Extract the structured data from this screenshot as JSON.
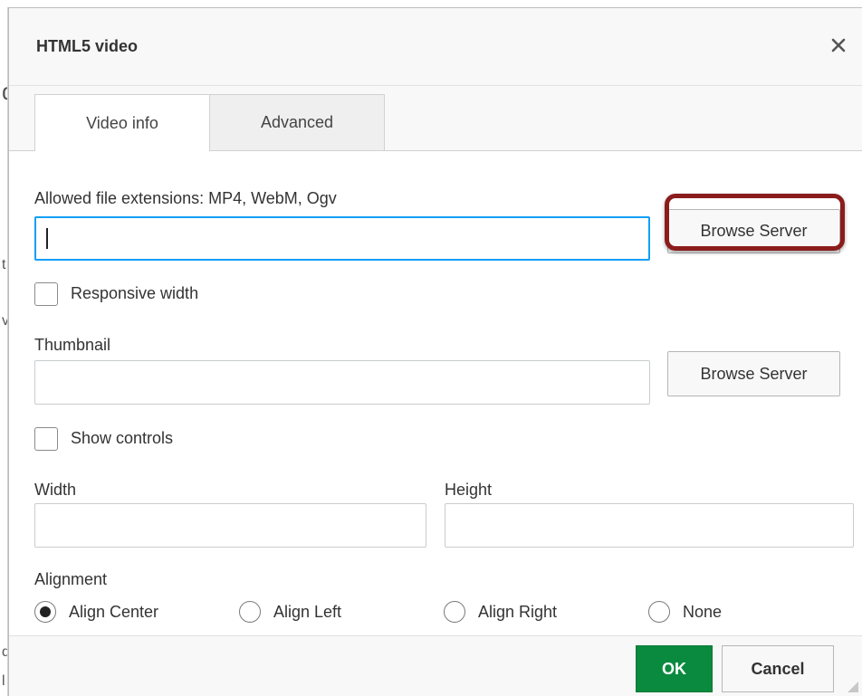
{
  "background": {
    "fragments": [
      "d",
      "t",
      "v",
      "d",
      "l"
    ]
  },
  "dialog": {
    "title": "HTML5 video",
    "close_icon": "close-icon",
    "tabs": [
      {
        "label": "Video info",
        "active": true
      },
      {
        "label": "Advanced",
        "active": false
      }
    ],
    "video_source": {
      "label": "Allowed file extensions: MP4, WebM, Ogv",
      "value": "",
      "browse_label": "Browse Server",
      "highlight_color": "#8b1c1c"
    },
    "responsive_width": {
      "label": "Responsive width",
      "checked": false
    },
    "thumbnail": {
      "label": "Thumbnail",
      "value": "",
      "browse_label": "Browse Server"
    },
    "show_controls": {
      "label": "Show controls",
      "checked": false
    },
    "width": {
      "label": "Width",
      "value": ""
    },
    "height": {
      "label": "Height",
      "value": ""
    },
    "alignment": {
      "label": "Alignment",
      "options": [
        {
          "label": "Align Center",
          "selected": true
        },
        {
          "label": "Align Left",
          "selected": false
        },
        {
          "label": "Align Right",
          "selected": false
        },
        {
          "label": "None",
          "selected": false
        }
      ]
    },
    "footer": {
      "ok_label": "OK",
      "cancel_label": "Cancel",
      "ok_color": "#0a8a3e"
    }
  }
}
